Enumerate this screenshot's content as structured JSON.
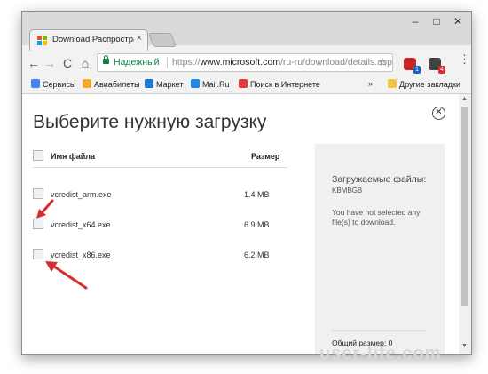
{
  "browser": {
    "tab_title": "Download Распростран",
    "tab_close": "×",
    "window_controls": {
      "minimize": "–",
      "maximize": "□",
      "close": "✕"
    },
    "nav": {
      "back": "←",
      "forward": "→",
      "reload": "C",
      "home": "⌂"
    },
    "address": {
      "secure_label": "Надежный",
      "url_scheme": "https://",
      "url_host": "www.microsoft.com",
      "url_path": "/ru-ru/download/details.aspx?i..."
    },
    "extensions": [
      {
        "name": "adblock-icon",
        "badge": "1",
        "color": "#c62828",
        "badge_color": "#1565c0"
      },
      {
        "name": "extension-icon",
        "badge": "4",
        "color": "#424242",
        "badge_color": "#d32f2f"
      }
    ],
    "menu_icon": "⋮"
  },
  "bookmarks": {
    "items": [
      {
        "label": "Сервисы",
        "icon": "apps-icon",
        "color": "#4285f4"
      },
      {
        "label": "Авиабилеты",
        "icon": "plane-icon",
        "color": "#f9a825"
      },
      {
        "label": "Маркет",
        "icon": "cart-icon",
        "color": "#1976d2"
      },
      {
        "label": "Mail.Ru",
        "icon": "mailru-icon",
        "color": "#1e88e5"
      },
      {
        "label": "Поиск в Интернете",
        "icon": "search-web-icon",
        "color": "#e53935"
      }
    ],
    "overflow": "»",
    "other": "Другие закладки"
  },
  "dialog": {
    "heading": "Выберите нужную загрузку",
    "close": "✕",
    "columns": {
      "name": "Имя файла",
      "size": "Размер"
    },
    "files": [
      {
        "name": "vcredist_arm.exe",
        "size": "1.4 MB"
      },
      {
        "name": "vcredist_x64.exe",
        "size": "6.9 MB"
      },
      {
        "name": "vcredist_x86.exe",
        "size": "6.2 MB"
      }
    ],
    "side": {
      "title": "Загружаемые файлы:",
      "subtitle": "KBMBGB",
      "message": "You have not selected any file(s) to download.",
      "total": "Общий размер: 0"
    }
  },
  "watermark": "user-life.com",
  "colors": {
    "arrow": "#d32f2f",
    "secure": "#0b8043",
    "page_bg": "#ffffff",
    "side_bg": "#f0f0f0"
  }
}
